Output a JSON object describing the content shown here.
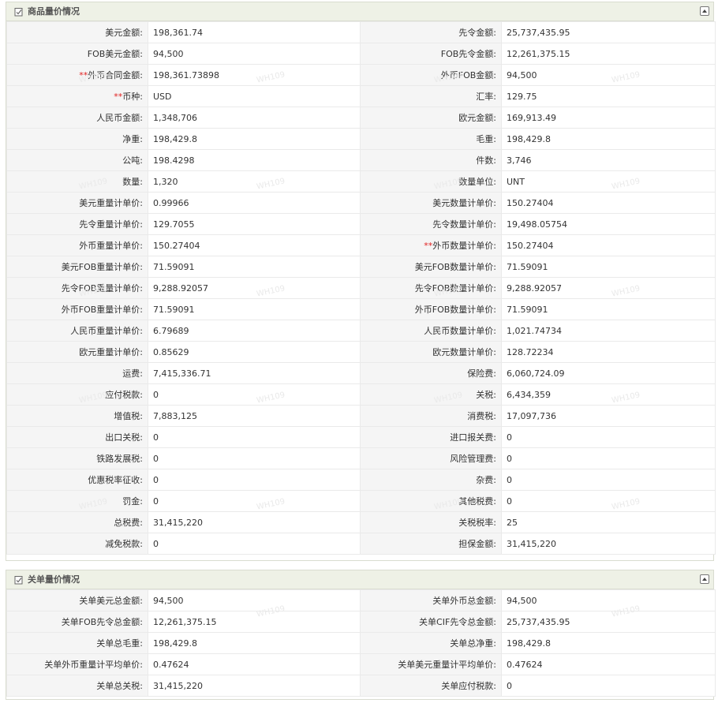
{
  "panel1": {
    "title": "商品量价情况",
    "required_mark": "**",
    "rows": [
      [
        {
          "label": "美元金额:",
          "value": "198,361.74"
        },
        {
          "label": "先令金额:",
          "value": "25,737,435.95"
        }
      ],
      [
        {
          "label": "FOB美元金额:",
          "value": "94,500"
        },
        {
          "label": "FOB先令金额:",
          "value": "12,261,375.15"
        }
      ],
      [
        {
          "label": "外币合同金额:",
          "value": "198,361.73898",
          "required": true
        },
        {
          "label": "外币FOB金额:",
          "value": "94,500"
        }
      ],
      [
        {
          "label": "币种:",
          "value": "USD",
          "required": true
        },
        {
          "label": "汇率:",
          "value": "129.75"
        }
      ],
      [
        {
          "label": "人民币金额:",
          "value": "1,348,706"
        },
        {
          "label": "欧元金额:",
          "value": "169,913.49"
        }
      ],
      [
        {
          "label": "净重:",
          "value": "198,429.8"
        },
        {
          "label": "毛重:",
          "value": "198,429.8"
        }
      ],
      [
        {
          "label": "公吨:",
          "value": "198.4298"
        },
        {
          "label": "件数:",
          "value": "3,746"
        }
      ],
      [
        {
          "label": "数量:",
          "value": "1,320"
        },
        {
          "label": "数量单位:",
          "value": "UNT"
        }
      ],
      [
        {
          "label": "美元重量计单价:",
          "value": "0.99966"
        },
        {
          "label": "美元数量计单价:",
          "value": "150.27404"
        }
      ],
      [
        {
          "label": "先令重量计单价:",
          "value": "129.7055"
        },
        {
          "label": "先令数量计单价:",
          "value": "19,498.05754"
        }
      ],
      [
        {
          "label": "外币重量计单价:",
          "value": "150.27404"
        },
        {
          "label": "外币数量计单价:",
          "value": "150.27404",
          "required": true
        }
      ],
      [
        {
          "label": "美元FOB重量计单价:",
          "value": "71.59091"
        },
        {
          "label": "美元FOB数量计单价:",
          "value": "71.59091"
        }
      ],
      [
        {
          "label": "先令FOB重量计单价:",
          "value": "9,288.92057"
        },
        {
          "label": "先令FOB数量计单价:",
          "value": "9,288.92057"
        }
      ],
      [
        {
          "label": "外币FOB重量计单价:",
          "value": "71.59091"
        },
        {
          "label": "外币FOB数量计单价:",
          "value": "71.59091"
        }
      ],
      [
        {
          "label": "人民币重量计单价:",
          "value": "6.79689"
        },
        {
          "label": "人民币数量计单价:",
          "value": "1,021.74734"
        }
      ],
      [
        {
          "label": "欧元重量计单价:",
          "value": "0.85629"
        },
        {
          "label": "欧元数量计单价:",
          "value": "128.72234"
        }
      ],
      [
        {
          "label": "运费:",
          "value": "7,415,336.71"
        },
        {
          "label": "保险费:",
          "value": "6,060,724.09"
        }
      ],
      [
        {
          "label": "应付税款:",
          "value": "0"
        },
        {
          "label": "关税:",
          "value": "6,434,359"
        }
      ],
      [
        {
          "label": "增值税:",
          "value": "7,883,125"
        },
        {
          "label": "消费税:",
          "value": "17,097,736"
        }
      ],
      [
        {
          "label": "出口关税:",
          "value": "0"
        },
        {
          "label": "进口报关费:",
          "value": "0"
        }
      ],
      [
        {
          "label": "铁路发展税:",
          "value": "0"
        },
        {
          "label": "风险管理费:",
          "value": "0"
        }
      ],
      [
        {
          "label": "优惠税率征收:",
          "value": "0"
        },
        {
          "label": "杂费:",
          "value": "0"
        }
      ],
      [
        {
          "label": "罚金:",
          "value": "0"
        },
        {
          "label": "其他税费:",
          "value": "0"
        }
      ],
      [
        {
          "label": "总税费:",
          "value": "31,415,220"
        },
        {
          "label": "关税税率:",
          "value": "25"
        }
      ],
      [
        {
          "label": "减免税款:",
          "value": "0"
        },
        {
          "label": "担保金额:",
          "value": "31,415,220"
        }
      ]
    ]
  },
  "panel2": {
    "title": "关单量价情况",
    "rows": [
      [
        {
          "label": "关单美元总金额:",
          "value": "94,500"
        },
        {
          "label": "关单外币总金额:",
          "value": "94,500"
        }
      ],
      [
        {
          "label": "关单FOB先令总金额:",
          "value": "12,261,375.15"
        },
        {
          "label": "关单CIF先令总金额:",
          "value": "25,737,435.95"
        }
      ],
      [
        {
          "label": "关单总毛重:",
          "value": "198,429.8"
        },
        {
          "label": "关单总净重:",
          "value": "198,429.8"
        }
      ],
      [
        {
          "label": "关单外币重量计平均单价:",
          "value": "0.47624"
        },
        {
          "label": "关单美元重量计平均单价:",
          "value": "0.47624"
        }
      ],
      [
        {
          "label": "关单总关税:",
          "value": "31,415,220"
        },
        {
          "label": "关单应付税款:",
          "value": "0"
        }
      ]
    ]
  },
  "watermark": "WH109",
  "colors": {
    "header_bg": "#eef1e6",
    "label_bg": "#f5f5f5",
    "required": "#e02020",
    "border": "#d9dcd0"
  },
  "icons": {
    "header_icon": "checklist-icon",
    "collapse_icon": "collapse-up-icon"
  }
}
